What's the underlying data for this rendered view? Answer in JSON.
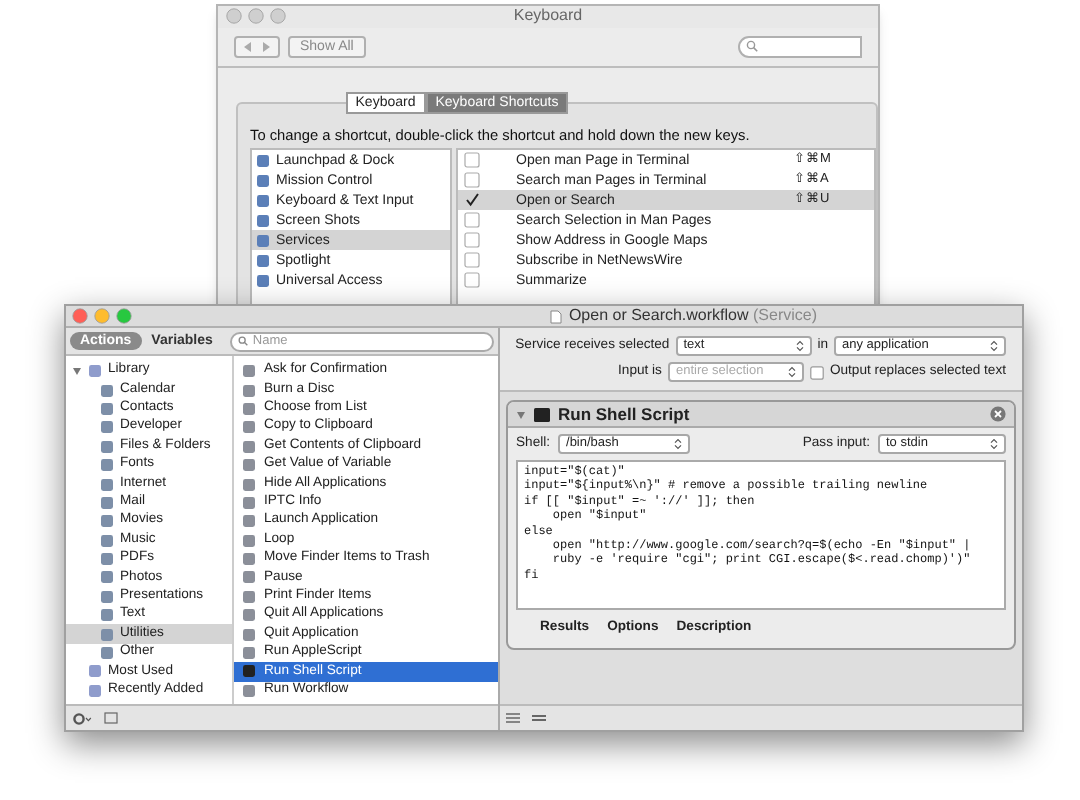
{
  "keyboard_window": {
    "title": "Keyboard",
    "show_all": "Show All",
    "tabs": [
      {
        "label": "Keyboard",
        "selected": false
      },
      {
        "label": "Keyboard Shortcuts",
        "selected": true
      }
    ],
    "instruction": "To change a shortcut, double-click the shortcut and hold down the new keys.",
    "categories": [
      {
        "label": "Launchpad & Dock",
        "selected": false
      },
      {
        "label": "Mission Control",
        "selected": false
      },
      {
        "label": "Keyboard & Text Input",
        "selected": false
      },
      {
        "label": "Screen Shots",
        "selected": false
      },
      {
        "label": "Services",
        "selected": true
      },
      {
        "label": "Spotlight",
        "selected": false
      },
      {
        "label": "Universal Access",
        "selected": false
      }
    ],
    "shortcuts": [
      {
        "label": "Open man Page in Terminal",
        "checked": false,
        "selected": false,
        "shortcut": "⇧⌘M"
      },
      {
        "label": "Search man Pages in Terminal",
        "checked": false,
        "selected": false,
        "shortcut": "⇧⌘A"
      },
      {
        "label": "Open or Search",
        "checked": true,
        "selected": true,
        "shortcut": "⇧⌘U"
      },
      {
        "label": "Search Selection in Man Pages",
        "checked": false,
        "selected": false
      },
      {
        "label": "Show Address in Google Maps",
        "checked": false,
        "selected": false
      },
      {
        "label": "Subscribe in NetNewsWire",
        "checked": false,
        "selected": false
      },
      {
        "label": "Summarize",
        "checked": false,
        "selected": false
      }
    ]
  },
  "automator_window": {
    "title": "Open or Search.workflow",
    "title_suffix": "(Service)",
    "library_tabs": [
      {
        "label": "Actions",
        "selected": true
      },
      {
        "label": "Variables",
        "selected": false
      }
    ],
    "search": {
      "placeholder": "Name"
    },
    "library": [
      {
        "label": "Library",
        "expanded": true,
        "selected": false,
        "children": [
          {
            "label": "Calendar",
            "selected": false
          },
          {
            "label": "Contacts",
            "selected": false
          },
          {
            "label": "Developer",
            "selected": false
          },
          {
            "label": "Files & Folders",
            "selected": false
          },
          {
            "label": "Fonts",
            "selected": false
          },
          {
            "label": "Internet",
            "selected": false
          },
          {
            "label": "Mail",
            "selected": false
          },
          {
            "label": "Movies",
            "selected": false
          },
          {
            "label": "Music",
            "selected": false
          },
          {
            "label": "PDFs",
            "selected": false
          },
          {
            "label": "Photos",
            "selected": false
          },
          {
            "label": "Presentations",
            "selected": false
          },
          {
            "label": "Text",
            "selected": false
          },
          {
            "label": "Utilities",
            "selected": true
          },
          {
            "label": "Other",
            "selected": false
          }
        ]
      },
      {
        "label": "Most Used",
        "selected": false
      },
      {
        "label": "Recently Added",
        "selected": false
      }
    ],
    "actions": [
      {
        "label": "Ask for Confirmation",
        "selected": false
      },
      {
        "label": "Burn a Disc",
        "selected": false
      },
      {
        "label": "Choose from List",
        "selected": false
      },
      {
        "label": "Copy to Clipboard",
        "selected": false
      },
      {
        "label": "Get Contents of Clipboard",
        "selected": false
      },
      {
        "label": "Get Value of Variable",
        "selected": false
      },
      {
        "label": "Hide All Applications",
        "selected": false
      },
      {
        "label": "IPTC Info",
        "selected": false
      },
      {
        "label": "Launch Application",
        "selected": false
      },
      {
        "label": "Loop",
        "selected": false
      },
      {
        "label": "Move Finder Items to Trash",
        "selected": false
      },
      {
        "label": "Pause",
        "selected": false
      },
      {
        "label": "Print Finder Items",
        "selected": false
      },
      {
        "label": "Quit All Applications",
        "selected": false
      },
      {
        "label": "Quit Application",
        "selected": false
      },
      {
        "label": "Run AppleScript",
        "selected": false
      },
      {
        "label": "Run Shell Script",
        "selected": true
      },
      {
        "label": "Run Workflow",
        "selected": false
      }
    ],
    "service": {
      "receives_label": "Service receives selected",
      "input_type": "text",
      "in_label": "in",
      "application": "any application",
      "input_is_label": "Input is",
      "input_is": {
        "value": "entire selection",
        "disabled": true
      },
      "output_replaces": {
        "label": "Output replaces selected text",
        "checked": false
      }
    },
    "action_card": {
      "title": "Run Shell Script",
      "shell_label": "Shell:",
      "shell": "/bin/bash",
      "pass_input_label": "Pass input:",
      "pass_input": "to stdin",
      "code": [
        "input=\"$(cat)\"",
        "input=\"${input%\\n}\" # remove a possible trailing newline",
        "if [[ \"$input\" =~ '://' ]]; then",
        "    open \"$input\"",
        "else",
        "    open \"http://www.google.com/search?q=$(echo -En \"$input\" |",
        "    ruby -e 'require \"cgi\"; print CGI.escape($<.read.chomp)')\"",
        "fi"
      ],
      "footer_tabs": [
        "Results",
        "Options",
        "Description"
      ]
    }
  }
}
